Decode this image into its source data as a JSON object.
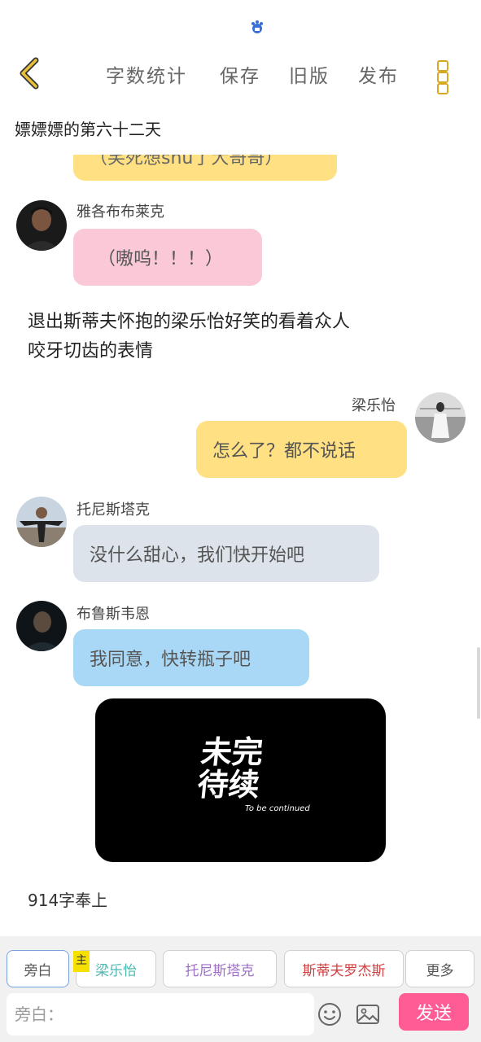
{
  "colors": {
    "accent_yellow": "#ffe082",
    "pink_bubble": "#fbc8d8",
    "grey_bubble": "#dde3ea",
    "blue_bubble": "#a9d8f7",
    "send_button": "#ff5c96",
    "back_arrow": "#d8a920"
  },
  "header": {
    "actions": [
      "字数统计",
      "保存",
      "旧版",
      "发布"
    ]
  },
  "chapter_title": "嫖嫖嫖的第六十二天",
  "messages": [
    {
      "speaker": "",
      "text": "（笑死想shu了大哥哥）",
      "bubble_color": "#ffe082"
    },
    {
      "speaker": "雅各布布莱克",
      "text": "（嗷呜！！！）",
      "bubble_color": "#fbc8d8"
    },
    {
      "narration": "退出斯蒂夫怀抱的梁乐怡好笑的看着众人咬牙切齿的表情"
    },
    {
      "speaker": "梁乐怡",
      "text": "怎么了？都不说话",
      "bubble_color": "#ffe082"
    },
    {
      "speaker": "托尼斯塔克",
      "text": "没什么甜心，我们快开始吧",
      "bubble_color": "#dde3ea"
    },
    {
      "speaker": "布鲁斯韦恩",
      "text": "我同意，快转瓶子吧",
      "bubble_color": "#a9d8f7"
    }
  ],
  "narration_line_1": "退出斯蒂夫怀抱的梁乐怡好笑的看着众人",
  "narration_line_2": "咬牙切齿的表情",
  "tbc_image": {
    "title_line_1": "未完",
    "title_line_2": "待续",
    "subtitle": "To be continued"
  },
  "word_count_text": "914字奉上",
  "roles": {
    "tabs": [
      "旁白",
      "梁乐怡",
      "托尼斯塔克",
      "斯蒂夫罗杰斯",
      "更多"
    ],
    "badge": "主"
  },
  "composer": {
    "placeholder": "旁白：",
    "send_label": "发送",
    "emoji_icon": "emoji-icon",
    "image_icon": "image-icon"
  }
}
